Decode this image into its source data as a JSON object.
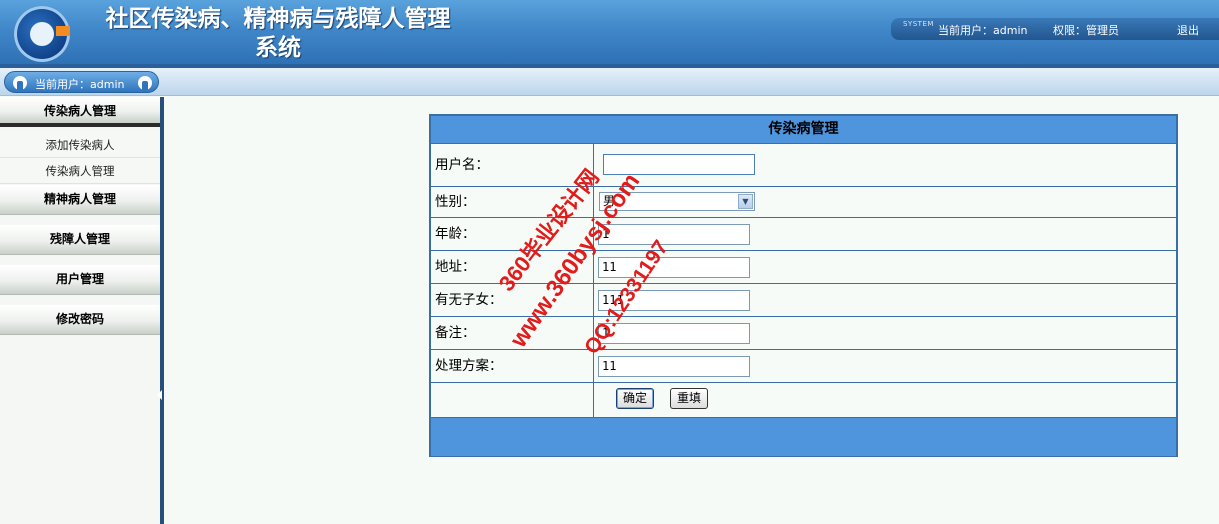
{
  "header": {
    "title_line1": "社区传染病、精神病与残障人管理",
    "title_line2": "系统",
    "system_mark": "SYSTEM",
    "current_user": "当前用户：admin",
    "permission": "权限：管理员",
    "logout": "退出"
  },
  "top_bar": {
    "current_user": "当前用户：admin"
  },
  "sidebar": {
    "section1": "传染病人管理",
    "section1_items": [
      "添加传染病人",
      "传染病人管理"
    ],
    "section2": "精神病人管理",
    "section3": "残障人管理",
    "section4": "用户管理",
    "section5": "修改密码"
  },
  "form": {
    "title": "传染病管理",
    "labels": {
      "username": "用户名：",
      "gender": "性别：",
      "age": "年龄：",
      "address": "地址：",
      "children": "有无子女：",
      "remark": "备注：",
      "plan": "处理方案："
    },
    "values": {
      "username": "",
      "gender": "男",
      "age": "1",
      "address": "11",
      "children": "111",
      "remark": "1",
      "plan": "11"
    },
    "buttons": {
      "confirm": "确定",
      "reset": "重填"
    }
  },
  "watermark": {
    "line1": "360毕业设计网",
    "line2": "www.360bysj.com",
    "line3": "QQ:12331197"
  }
}
